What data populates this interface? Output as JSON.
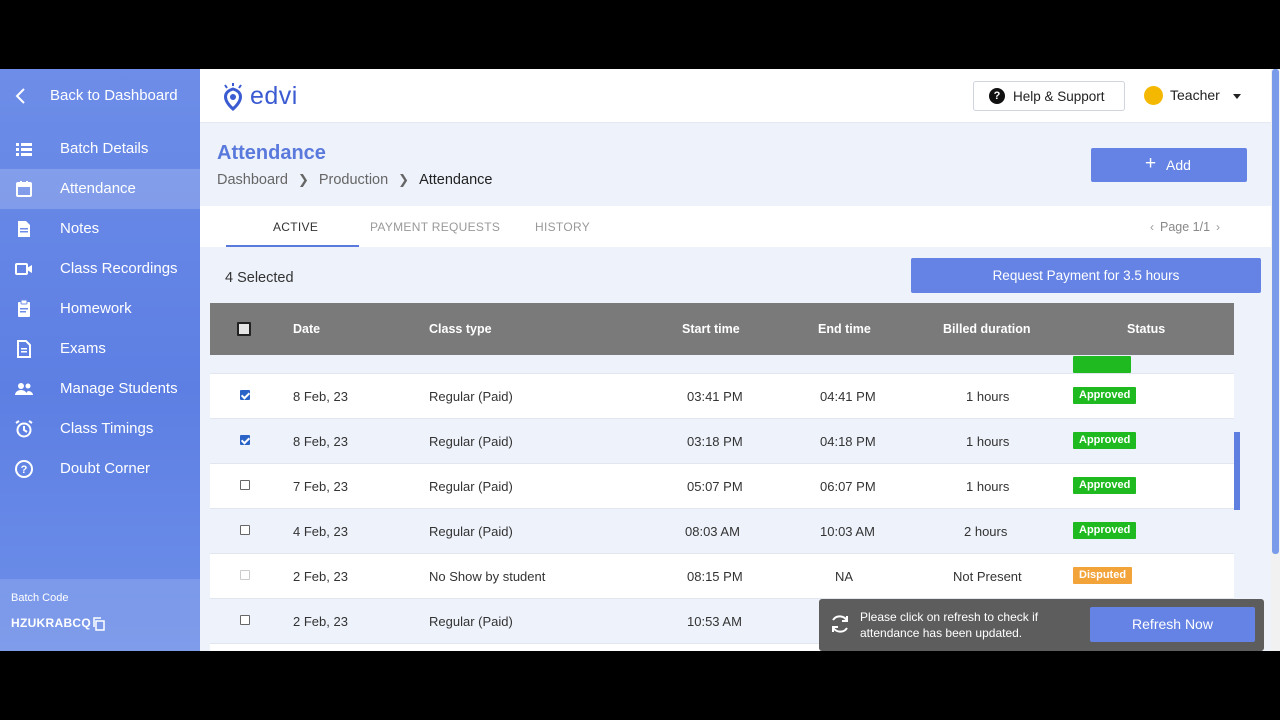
{
  "sidebar": {
    "back_label": "Back to Dashboard",
    "items": [
      {
        "label": "Batch Details",
        "icon": "list-icon"
      },
      {
        "label": "Attendance",
        "icon": "calendar-icon"
      },
      {
        "label": "Notes",
        "icon": "document-icon"
      },
      {
        "label": "Class Recordings",
        "icon": "video-icon"
      },
      {
        "label": "Homework",
        "icon": "clipboard-icon"
      },
      {
        "label": "Exams",
        "icon": "exam-icon"
      },
      {
        "label": "Manage Students",
        "icon": "people-icon"
      },
      {
        "label": "Class Timings",
        "icon": "alarm-icon"
      },
      {
        "label": "Doubt Corner",
        "icon": "question-icon"
      }
    ],
    "active_index": 1,
    "batch_code_title": "Batch Code",
    "batch_code": "HZUKRABCQ"
  },
  "header": {
    "logo_text": "edvi",
    "help_label": "Help & Support",
    "user_label": "Teacher"
  },
  "page": {
    "title": "Attendance",
    "breadcrumb": [
      "Dashboard",
      "Production",
      "Attendance"
    ],
    "add_label": "Add"
  },
  "tabs": [
    {
      "label": "ACTIVE",
      "active": true
    },
    {
      "label": "PAYMENT REQUESTS",
      "active": false
    },
    {
      "label": "HISTORY",
      "active": false
    }
  ],
  "pager": {
    "label": "Page 1/1"
  },
  "selection": {
    "selected_label": "4 Selected",
    "request_label": "Request Payment for 3.5 hours"
  },
  "table": {
    "headers": [
      "Date",
      "Class type",
      "Start time",
      "End time",
      "Billed duration",
      "Status"
    ],
    "rows": [
      {
        "date": "8 Feb, 23",
        "type": "Regular (Paid)",
        "start": "03:41 PM",
        "end": "04:41 PM",
        "billed": "1 hours",
        "status": "Approved",
        "checked": true
      },
      {
        "date": "8 Feb, 23",
        "type": "Regular (Paid)",
        "start": "03:18 PM",
        "end": "04:18 PM",
        "billed": "1 hours",
        "status": "Approved",
        "checked": true
      },
      {
        "date": "7 Feb, 23",
        "type": "Regular (Paid)",
        "start": "05:07 PM",
        "end": "06:07 PM",
        "billed": "1 hours",
        "status": "Approved",
        "checked": false
      },
      {
        "date": "4 Feb, 23",
        "type": "Regular (Paid)",
        "start": "08:03 AM",
        "end": "10:03 AM",
        "billed": "2 hours",
        "status": "Approved",
        "checked": false
      },
      {
        "date": "2 Feb, 23",
        "type": "No Show by student",
        "start": "08:15 PM",
        "end": "NA",
        "billed": "Not Present",
        "status": "Disputed",
        "checked": false
      },
      {
        "date": "2 Feb, 23",
        "type": "Regular (Paid)",
        "start": "10:53 AM",
        "end": "",
        "billed": "",
        "status": "",
        "checked": false
      }
    ]
  },
  "toast": {
    "message": "Please click on refresh to check if attendance has been updated.",
    "button_label": "Refresh Now"
  },
  "colors": {
    "sidebar": "#6d8de8",
    "accent": "#6483e4",
    "title": "#5a79dc",
    "approved": "#1fba1f",
    "disputed": "#f2a33a",
    "table_header": "#7a7a7a"
  }
}
